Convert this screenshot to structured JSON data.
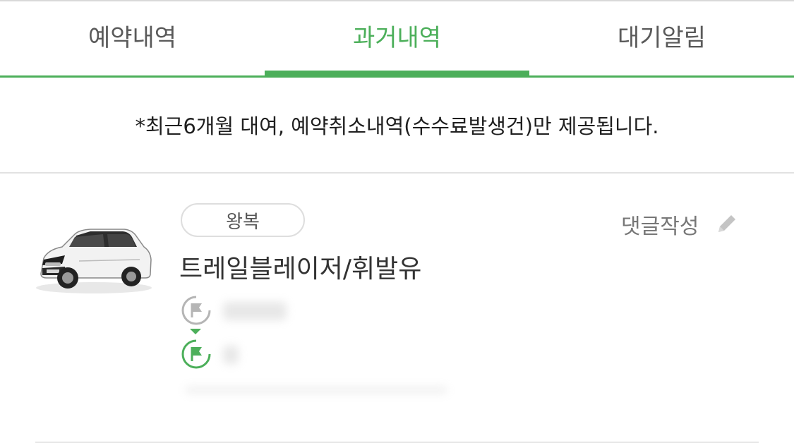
{
  "tabs": [
    {
      "label": "예약내역",
      "active": false
    },
    {
      "label": "과거내역",
      "active": true
    },
    {
      "label": "대기알림",
      "active": false
    }
  ],
  "notice": {
    "text": "*최근6개월 대여, 예약취소내역(수수료발생건)만 제공됩니다."
  },
  "record": {
    "trip_type": "왕복",
    "car_name": "트레일블레이저/휘발유",
    "comment_label": "댓글작성",
    "icons": [
      "car-image",
      "start-flag-icon",
      "end-flag-icon",
      "pencil-icon"
    ]
  },
  "colors": {
    "accent": "#4caf5a",
    "inactive_text": "#5a5a5a",
    "divider": "#e2e2e2"
  }
}
